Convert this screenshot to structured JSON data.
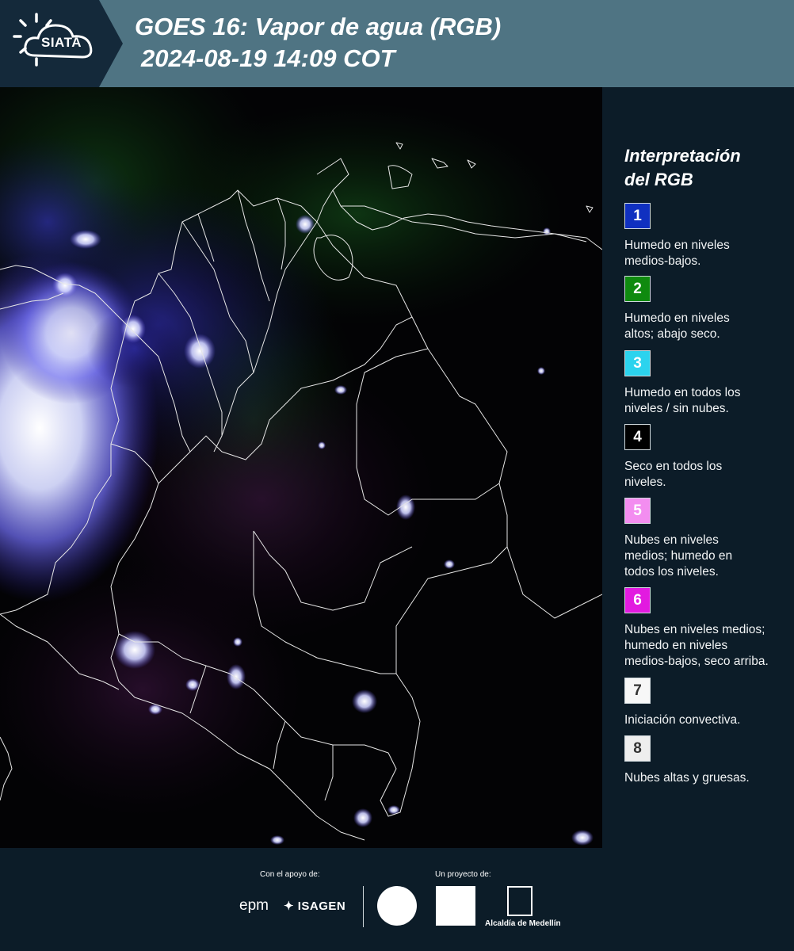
{
  "header": {
    "logo_text": "SIATA",
    "title": "GOES 16: Vapor de agua (RGB)",
    "datetime": "2024-08-19 14:09 COT"
  },
  "legend": {
    "title_line1": "Interpretación",
    "title_line2": "del RGB",
    "items": [
      {
        "num": "1",
        "color": "#1030c0",
        "text_color": "#ffffff",
        "desc_lines": [
          "Humedo en niveles",
          "medios-bajos."
        ]
      },
      {
        "num": "2",
        "color": "#0f8a0f",
        "text_color": "#ffffff",
        "desc_lines": [
          "Humedo en niveles",
          "altos; abajo seco."
        ]
      },
      {
        "num": "3",
        "color": "#2bd3ee",
        "text_color": "#ffffff",
        "desc_lines": [
          "Humedo en todos los",
          "niveles / sin nubes."
        ]
      },
      {
        "num": "4",
        "color": "#000000",
        "text_color": "#ffffff",
        "desc_lines": [
          "Seco en todos los",
          "niveles."
        ]
      },
      {
        "num": "5",
        "color": "#f38df0",
        "text_color": "#ffffff",
        "desc_lines": [
          "Nubes en niveles",
          "medios; humedo en",
          "todos los niveles."
        ]
      },
      {
        "num": "6",
        "color": "#e21ae0",
        "text_color": "#ffffff",
        "desc_lines": [
          "Nubes en niveles medios;",
          "humedo en niveles",
          "medios-bajos, seco arriba."
        ]
      },
      {
        "num": "7",
        "color": "#f7f7f7",
        "text_color": "#333333",
        "desc_lines": [
          "Iniciación convectiva."
        ]
      },
      {
        "num": "8",
        "color": "#eeeeee",
        "text_color": "#333333",
        "desc_lines": [
          "Nubes altas y gruesas."
        ]
      }
    ]
  },
  "footer": {
    "support_label": "Con el apoyo de:",
    "project_label": "Un proyecto de:",
    "epm": "epm",
    "isagen": "ISAGEN",
    "medellin": "Alcaldía de Medellín"
  }
}
